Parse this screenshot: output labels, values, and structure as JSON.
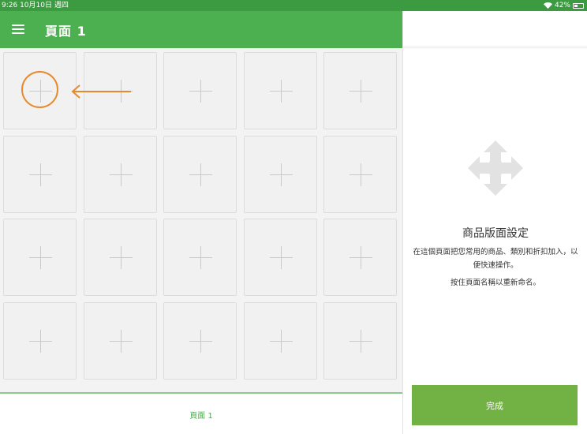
{
  "status_bar": {
    "time_date": "9:26  10月10日 週四",
    "battery": "42%",
    "battery_level": 0.42
  },
  "header": {
    "title": "頁面 1"
  },
  "grid": {
    "rows": 4,
    "columns": 5
  },
  "bottom_tabs": [
    {
      "label": "頁面 1",
      "active": true
    }
  ],
  "side_panel": {
    "title": "商品版面設定",
    "description": "在這個頁面把您常用的商品、類別和折扣加入，以便快速操作。",
    "hint": "按住頁面名稱以重新命名。",
    "done_label": "完成"
  },
  "colors": {
    "status_bar": "#3c9b40",
    "header": "#4caf50",
    "accent": "#4caf50",
    "done_button": "#72b144",
    "annotation": "#e68a2e"
  },
  "icons": {
    "menu": "menu-icon",
    "move": "move-arrows-icon",
    "wifi": "wifi-icon",
    "battery": "battery-icon"
  }
}
